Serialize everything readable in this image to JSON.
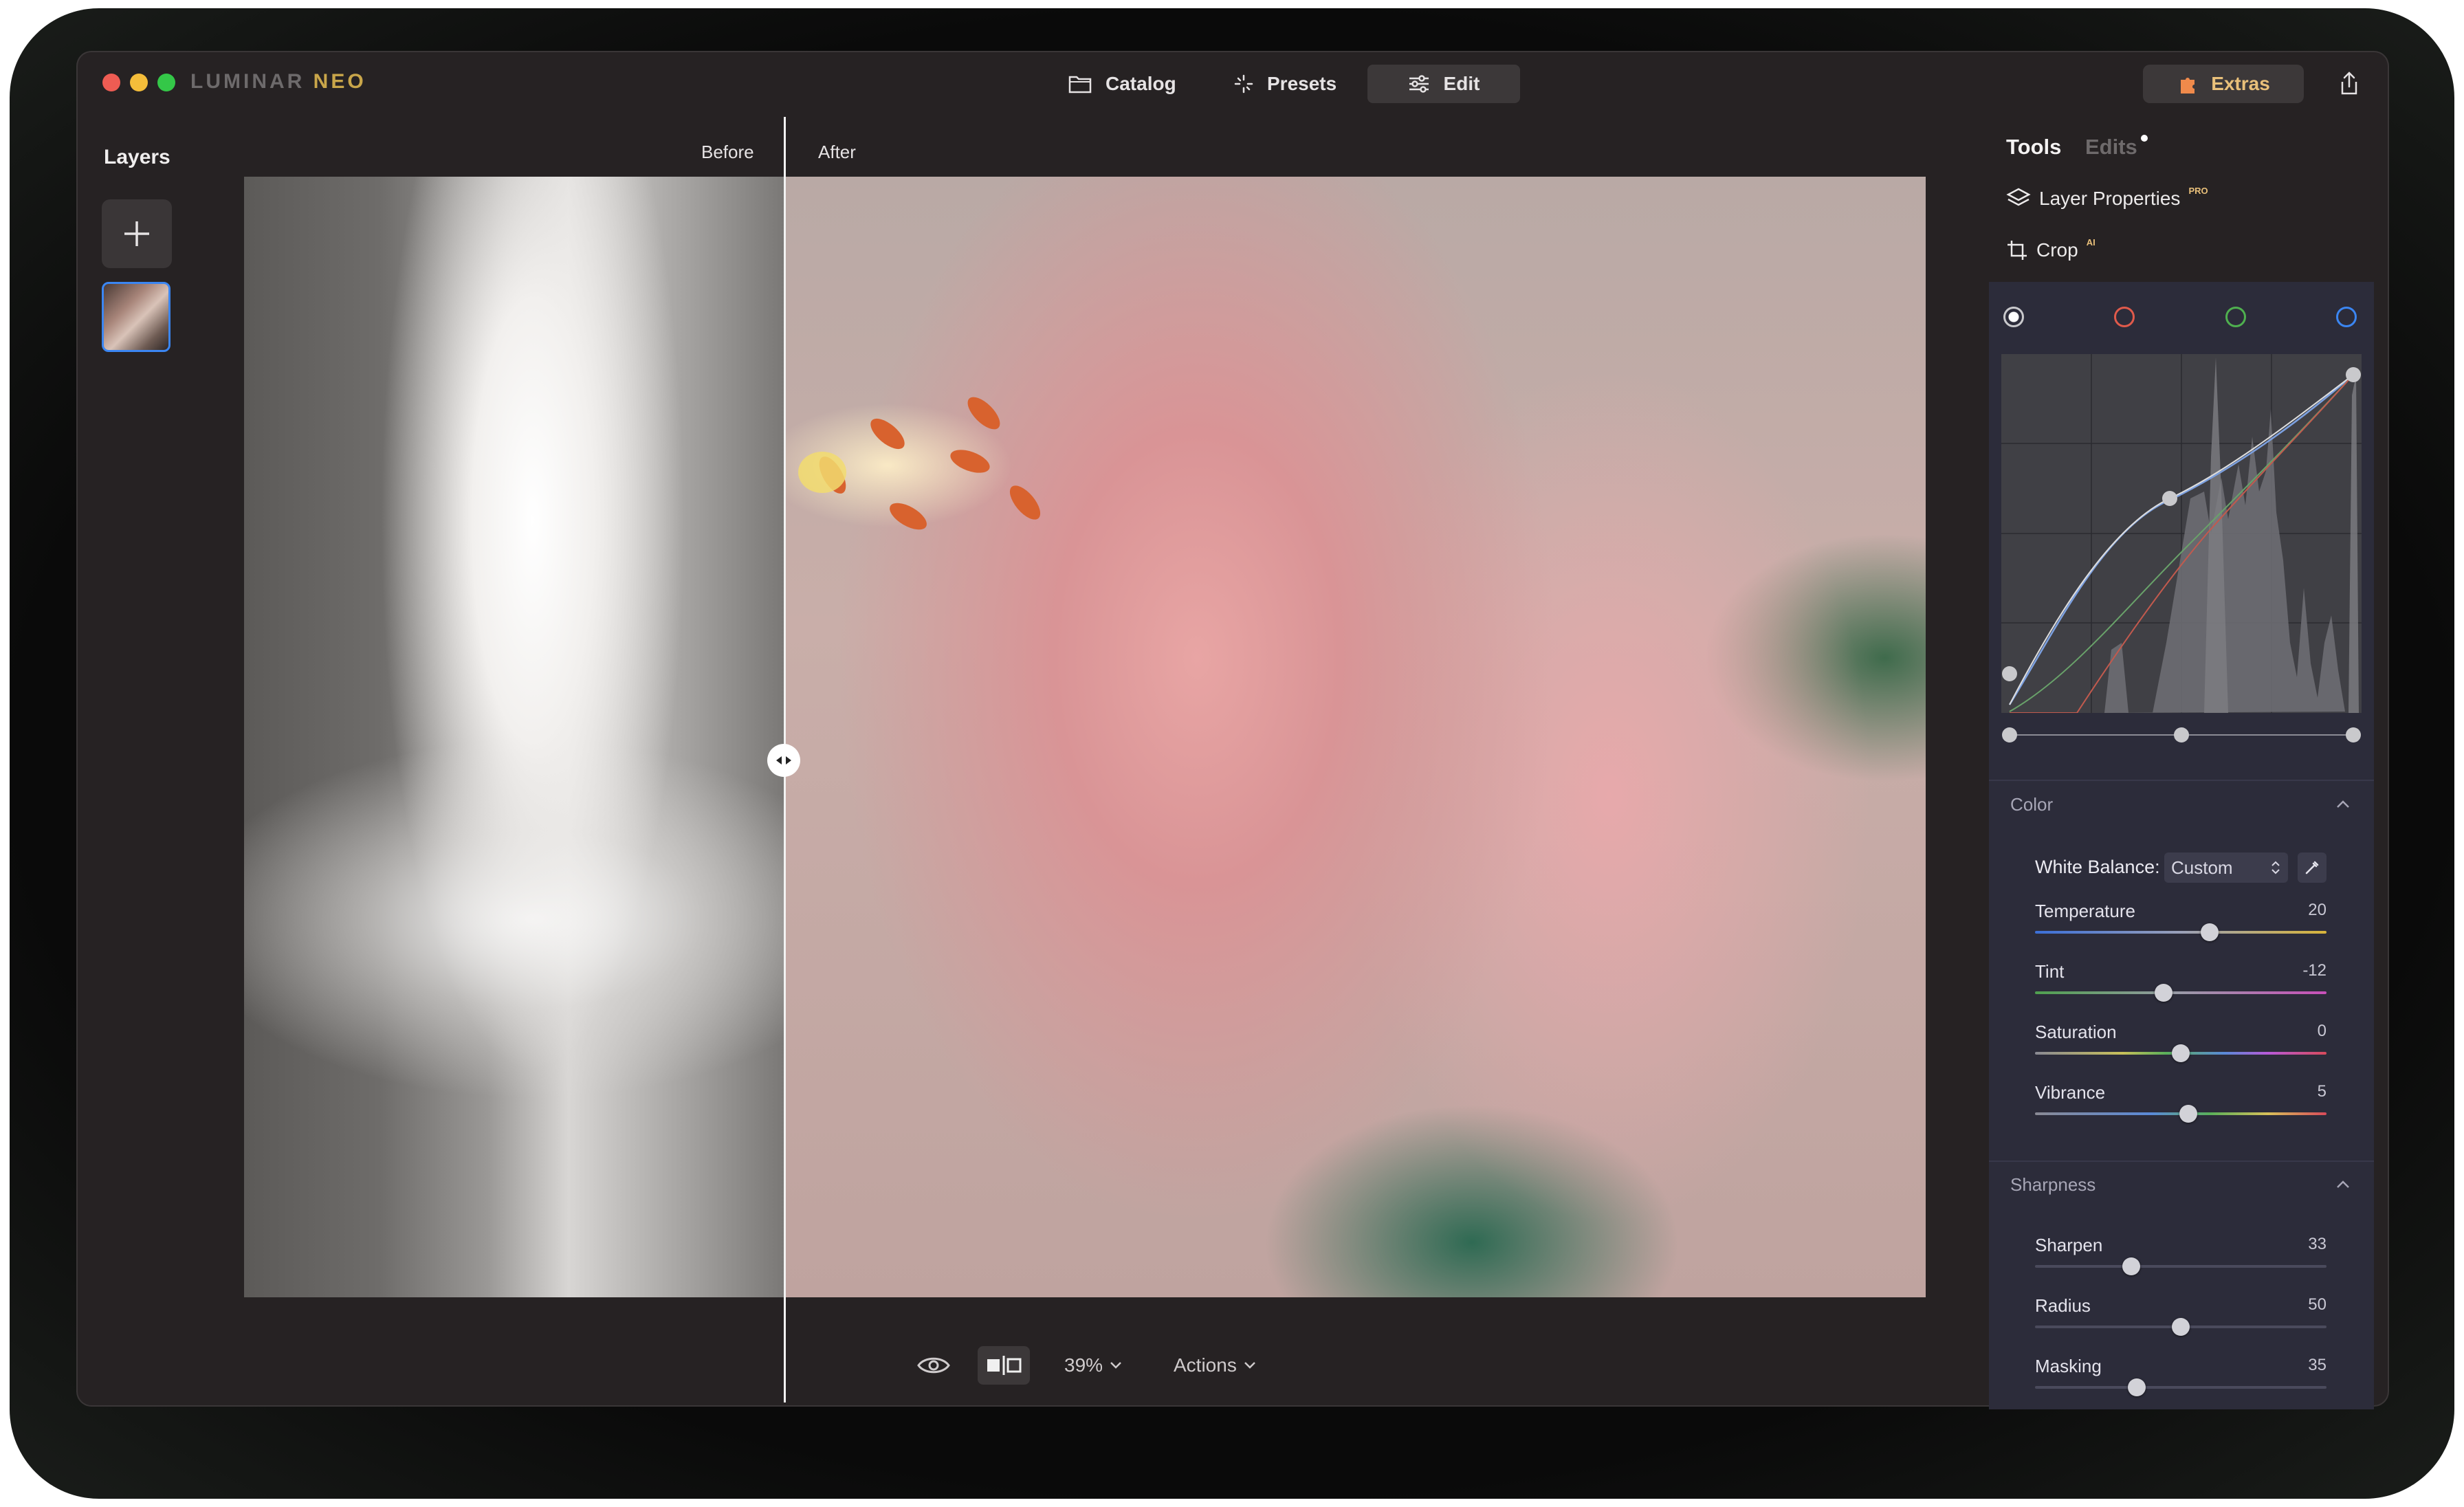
{
  "app": {
    "logo_main": "LUMINAR",
    "logo_accent": "NEO"
  },
  "nav": {
    "catalog": "Catalog",
    "presets": "Presets",
    "edit": "Edit",
    "extras": "Extras"
  },
  "layers": {
    "title": "Layers"
  },
  "canvas": {
    "before_label": "Before",
    "after_label": "After"
  },
  "bottom_toolbar": {
    "zoom": "39%",
    "actions": "Actions"
  },
  "right_panel": {
    "tabs": {
      "tools": "Tools",
      "edits": "Edits"
    },
    "tools": [
      {
        "label": "Layer Properties",
        "badge": "PRO",
        "icon": "layers-icon"
      },
      {
        "label": "Crop",
        "badge": "AI",
        "icon": "crop-icon"
      }
    ],
    "curve_channels": [
      {
        "name": "luminosity",
        "color": "#c9c9cc"
      },
      {
        "name": "red",
        "color": "#e05a4b"
      },
      {
        "name": "green",
        "color": "#4fb04f"
      },
      {
        "name": "blue",
        "color": "#3b86f2"
      }
    ],
    "color_section": {
      "title": "Color",
      "white_balance_label": "White Balance:",
      "white_balance_value": "Custom",
      "sliders": [
        {
          "name": "Temperature",
          "value": "20",
          "position": 0.6
        },
        {
          "name": "Tint",
          "value": "-12",
          "position": 0.44
        },
        {
          "name": "Saturation",
          "value": "0",
          "position": 0.5
        },
        {
          "name": "Vibrance",
          "value": "5",
          "position": 0.525
        }
      ]
    },
    "sharpness_section": {
      "title": "Sharpness",
      "sliders": [
        {
          "name": "Sharpen",
          "value": "33",
          "position": 0.33
        },
        {
          "name": "Radius",
          "value": "50",
          "position": 0.5
        },
        {
          "name": "Masking",
          "value": "35",
          "position": 0.35
        }
      ]
    }
  },
  "colors": {
    "accent_blue": "#3b86f2",
    "extras_gold": "#e9c07a",
    "panel_bg": "#2c2c3a",
    "window_bg": "#262223"
  }
}
